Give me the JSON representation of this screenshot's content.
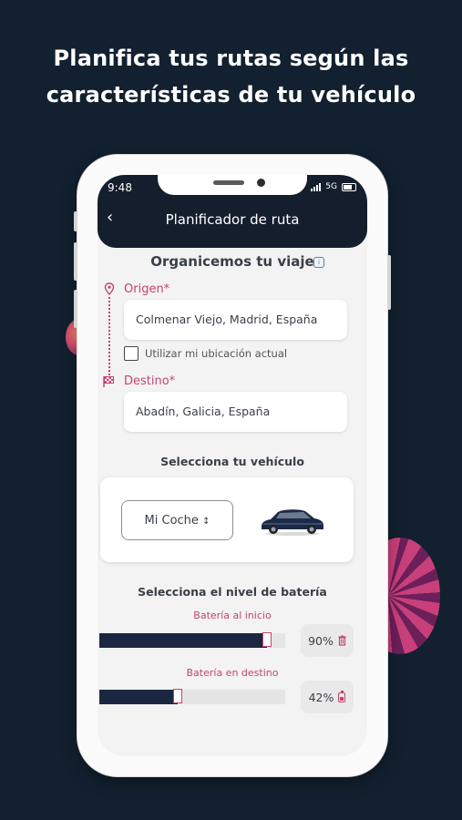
{
  "promo": {
    "headline_line1": "Planifica tus rutas según las",
    "headline_line2": "características de tu vehículo"
  },
  "status_bar": {
    "time": "9:48",
    "network": "5G"
  },
  "header": {
    "back_icon": "chevron-left-icon",
    "title": "Planificador de ruta"
  },
  "trip": {
    "title": "Organicemos tu viaje",
    "origin_label": "Origen*",
    "origin_value": "Colmenar Viejo, Madrid, España",
    "use_location_label": "Utilizar mi ubicación actual",
    "use_location_checked": false,
    "destination_label": "Destino*",
    "destination_value": "Abadín, Galicia, España"
  },
  "vehicle": {
    "title": "Selecciona tu vehículo",
    "selected": "Mi Coche",
    "select_icon": "chevron-updown-icon",
    "image_icon": "car-image"
  },
  "battery": {
    "title": "Selecciona el nivel de batería",
    "start_label": "Batería al inicio",
    "start_value": "90%",
    "start_percent": 90,
    "end_label": "Batería en destino",
    "end_value": "42%",
    "end_percent": 42
  },
  "colors": {
    "accent": "#c4456b",
    "dark": "#141e2c",
    "background": "#12202f"
  }
}
